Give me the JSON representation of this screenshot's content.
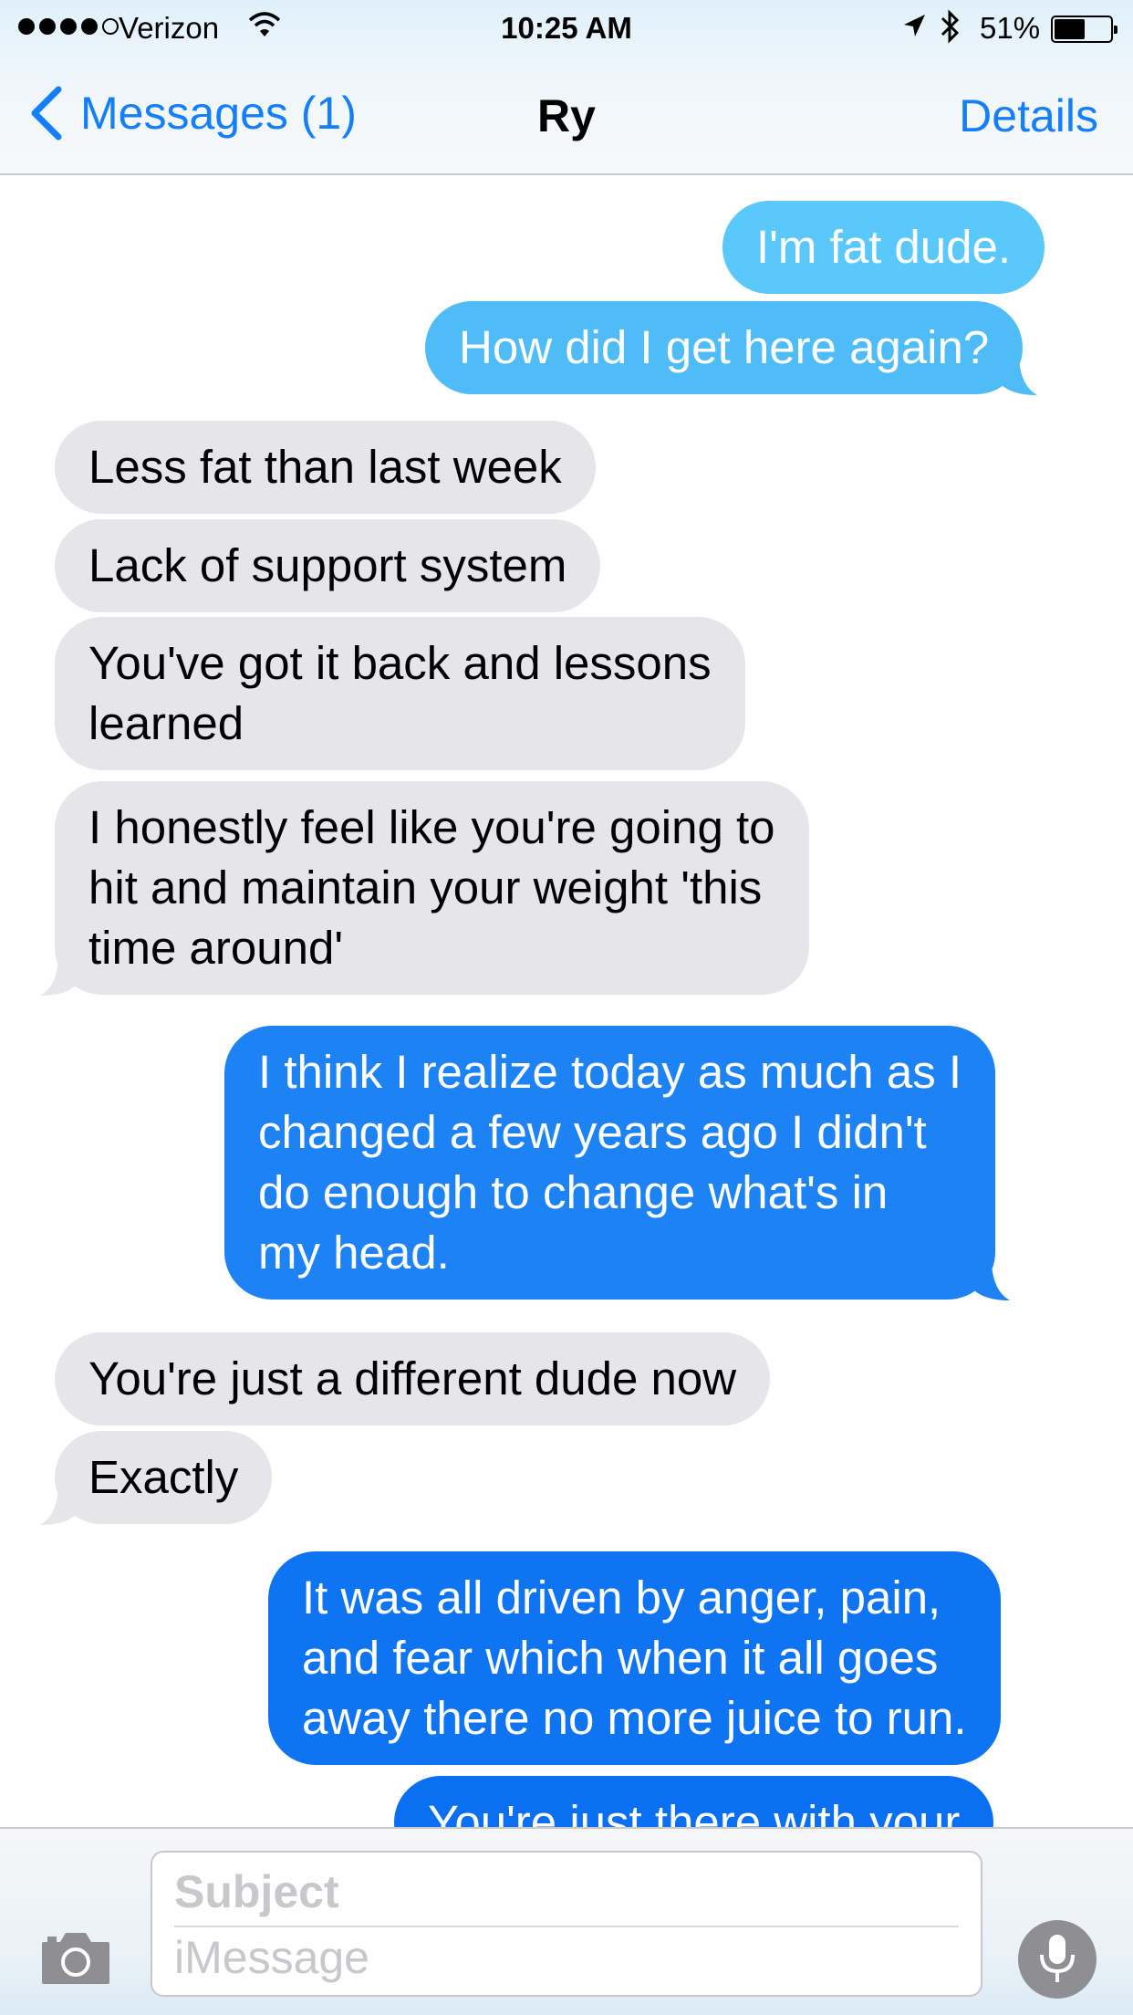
{
  "status_bar": {
    "carrier": "Verizon",
    "time": "10:25 AM",
    "battery": "51%",
    "icons": [
      "signal-dots-icon",
      "wifi-icon",
      "location-arrow-icon",
      "bluetooth-icon",
      "battery-icon"
    ]
  },
  "nav": {
    "back_label": "Messages (1)",
    "title": "Ry",
    "details_label": "Details"
  },
  "messages": [
    {
      "from": "me",
      "text": "I'm fat dude."
    },
    {
      "from": "me",
      "text": "How did I get here again?"
    },
    {
      "from": "them",
      "text": "Less fat than last week"
    },
    {
      "from": "them",
      "text": "Lack of support system"
    },
    {
      "from": "them",
      "lines": [
        "You've got it back and lessons",
        "learned"
      ]
    },
    {
      "from": "them",
      "lines": [
        "I honestly feel like you're going to",
        "hit and maintain your weight 'this",
        "time around'"
      ]
    },
    {
      "from": "me",
      "lines": [
        "I think I realize today as much as I",
        "changed a few years ago I didn't",
        "do enough to change what's in",
        "my head."
      ]
    },
    {
      "from": "them",
      "text": "You're just a different dude now"
    },
    {
      "from": "them",
      "text": "Exactly"
    },
    {
      "from": "me",
      "lines": [
        "It was all driven by anger, pain,",
        "and fear which when it all goes",
        "away there no more juice to run."
      ]
    },
    {
      "from": "me",
      "text": "You're just there with your"
    }
  ],
  "input": {
    "subject_placeholder": "Subject",
    "message_placeholder": "iMessage",
    "icons": [
      "camera-icon",
      "microphone-icon"
    ]
  },
  "colors": {
    "ios_blue": "#147efb",
    "incoming_bubble": "#e5e5ea",
    "outgoing_gradient": [
      "#5ac8fa",
      "#1d83f4",
      "#0a6ff0"
    ]
  }
}
